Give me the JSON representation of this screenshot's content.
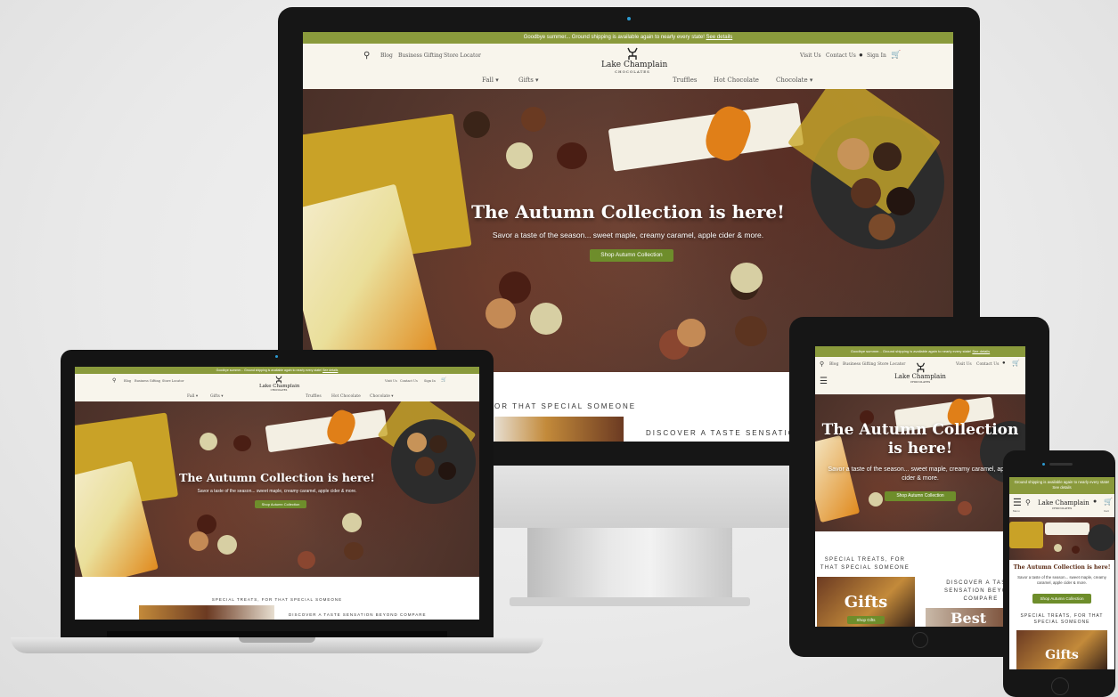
{
  "site": {
    "banner_text": "Goodbye summer... Ground shipping is available again to nearly every state!",
    "banner_link": "See details",
    "banner_mobile": "Ground shipping is available again to nearly every state! See details",
    "logo_name": "Lake Champlain",
    "logo_sub": "CHOCOLATES",
    "top_links": [
      "Blog",
      "Business Gifting",
      "Store Locator"
    ],
    "right_links": [
      "Visit Us",
      "Contact Us",
      "Sign In"
    ],
    "nav_items": [
      "Fall",
      "Gifts",
      "Truffles",
      "Hot Chocolate",
      "Chocolate"
    ],
    "hero_title": "The Autumn Collection is here!",
    "hero_sub": "Savor a taste of the season... sweet maple, creamy caramel, apple cider & more.",
    "cta": "Shop Autumn Collection",
    "section_special": "SPECIAL TREATS, FOR THAT SPECIAL SOMEONE",
    "section_special_partial": "OR THAT SPECIAL SOMEONE",
    "section_discover": "DISCOVER A TASTE SENSATION BEYOND COMPARE",
    "section_discover_partial": "DISCOVER A TASTE SENSATION BEY",
    "gifts_label": "Gifts",
    "shop_gifts": "Shop Gifts",
    "tablet_discover": "DISCOVER A TASTE SENSATION BEYOND COMPARE",
    "tablet_best": "Best",
    "phone_menu": "Menu",
    "phone_cart": "Cart"
  },
  "colors": {
    "banner": "#8a9a3c",
    "cta": "#6e8d2b",
    "header_bg": "#f8f5ec"
  },
  "icons": [
    "search-icon",
    "user-icon",
    "cart-icon",
    "hamburger-icon",
    "chevron-down-icon",
    "deer-logo-icon"
  ]
}
